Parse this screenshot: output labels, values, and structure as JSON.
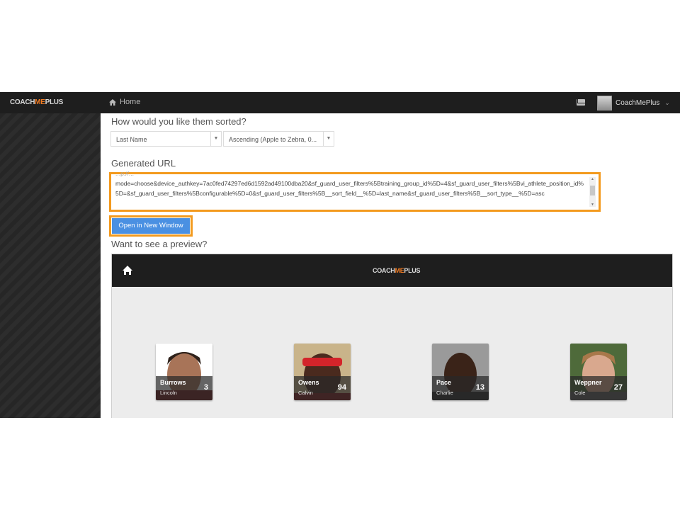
{
  "topbar": {
    "logo_coach": "COACH",
    "logo_me": "ME",
    "logo_plus": "PLUS",
    "home_icon": "home-icon",
    "home_label": "Home",
    "mail_icon": "envelope-icon",
    "user_name": "CoachMePlus",
    "chevron_icon": "chevron-down-icon"
  },
  "sort": {
    "heading": "How would you like them sorted?",
    "field_value": "Last Name",
    "order_value": "Ascending (Apple to Zebra, 0..."
  },
  "url": {
    "heading": "Generated URL",
    "partial_top": "...p://...",
    "value": "mode=choose&device_authkey=7ac0fed74297ed6d1592ad49100dba20&sf_guard_user_filters%5Btraining_group_id%5D=4&sf_guard_user_filters%5Bvi_athlete_position_id%5D=&sf_guard_user_filters%5Bconfigurable%5D=0&sf_guard_user_filters%5B__sort_field__%5D=last_name&sf_guard_user_filters%5B__sort_type__%5D=asc",
    "open_button": "Open in New Window"
  },
  "preview": {
    "heading": "Want to see a preview?",
    "logo_coach": "COACH",
    "logo_me": "ME",
    "logo_plus": "PLUS",
    "athletes": [
      {
        "last": "Burrows",
        "first": "Lincoln",
        "number": "3"
      },
      {
        "last": "Owens",
        "first": "Calvin",
        "number": "94"
      },
      {
        "last": "Pace",
        "first": "Charlie",
        "number": "13"
      },
      {
        "last": "Weppner",
        "first": "Cole",
        "number": "27"
      }
    ]
  },
  "colors": {
    "accent_orange": "#f39a1e",
    "button_blue": "#4a90e2",
    "topbar_bg": "#1e1e1e"
  }
}
